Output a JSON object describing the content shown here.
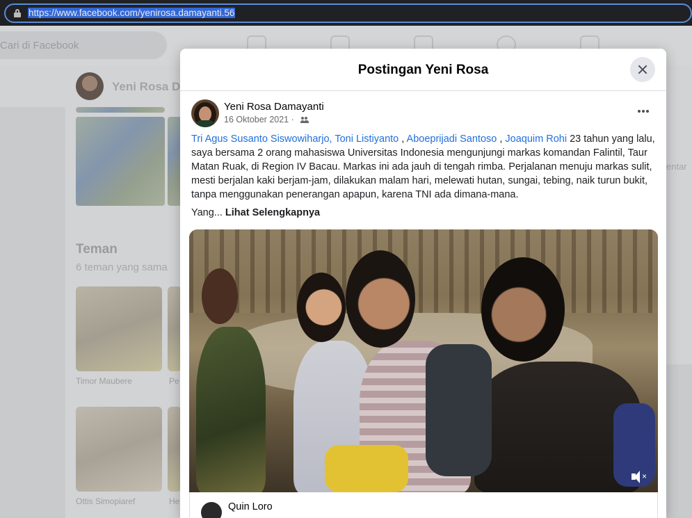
{
  "browser": {
    "url": "https://www.facebook.com/yenirosa.damayanti.56"
  },
  "background": {
    "search_placeholder": "Cari di Facebook",
    "profile_name": "Yeni Rosa Da",
    "friends_title": "Teman",
    "friends_subtitle": "6 teman yang sama",
    "friends": [
      {
        "name": "Timor Maubere"
      },
      {
        "name": "Pe"
      },
      {
        "name": "Ottis Simopiaref"
      },
      {
        "name": "He"
      }
    ],
    "right_text": "entar"
  },
  "modal": {
    "title": "Postingan Yeni Rosa",
    "author": "Yeni Rosa Damayanti",
    "date": "16 Oktober 2021 ·",
    "tags": [
      "Tri Agus Susanto Siswowiharjo,",
      "Toni Listiyanto",
      "Aboeprijadi Santoso",
      "Joaquim Rohi"
    ],
    "tag_separators": [
      " ",
      " , ",
      " , "
    ],
    "body_text": "  23 tahun yang lalu, saya  bersama 2 orang mahasiswa Universitas Indonesia mengunjungi markas komandan Falintil, Taur Matan Ruak, di Region IV Bacau. Markas ini ada jauh di tengah rimba. Perjalanan menuju markas sulit, mesti berjalan kaki berjam-jam,  dilakukan malam hari, melewati hutan, sungai, tebing, naik turun bukit, tanpa menggunakan penerangan apapun, karena TNI ada dimana-mana.",
    "truncated_prefix": "Yang... ",
    "see_more": "Lihat Selengkapnya",
    "shared_author": "Quin Loro"
  },
  "colors": {
    "link": "#216fdb",
    "address_highlight": "#3367d6"
  }
}
